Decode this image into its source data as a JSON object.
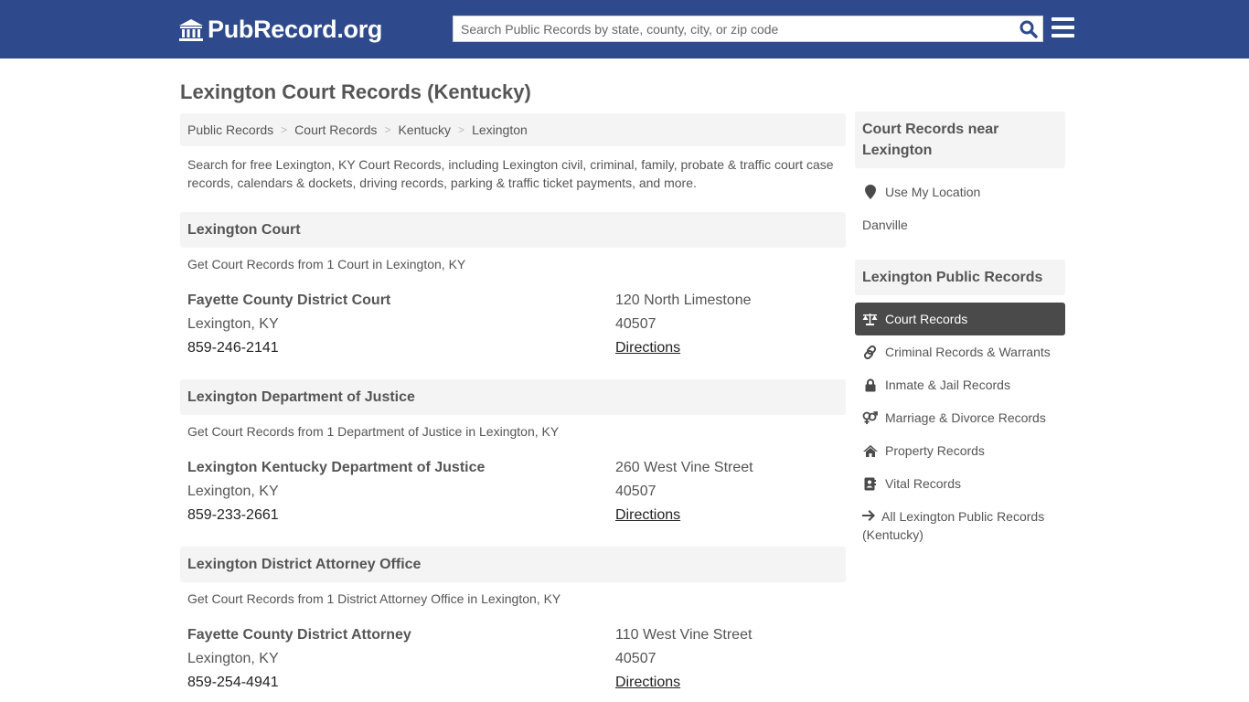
{
  "header": {
    "logo_text": "PubRecord.org",
    "search_placeholder": "Search Public Records by state, county, city, or zip code",
    "search_value": "",
    "brand_color": "#2e4a8c"
  },
  "page": {
    "title": "Lexington Court Records (Kentucky)",
    "breadcrumb": [
      "Public Records",
      "Court Records",
      "Kentucky",
      "Lexington"
    ],
    "intro": "Search for free Lexington, KY Court Records, including Lexington civil, criminal, family, probate & traffic court case records, calendars & dockets, driving records, parking & traffic ticket payments, and more."
  },
  "sections": [
    {
      "heading": "Lexington Court",
      "subtitle": "Get Court Records from 1 Court in Lexington, KY",
      "entry": {
        "name": "Fayette County District Court",
        "city": "Lexington, KY",
        "phone": "859-246-2141",
        "address": "120 North Limestone",
        "zip": "40507",
        "directions": "Directions"
      }
    },
    {
      "heading": "Lexington Department of Justice",
      "subtitle": "Get Court Records from 1 Department of Justice in Lexington, KY",
      "entry": {
        "name": "Lexington Kentucky Department of Justice",
        "city": "Lexington, KY",
        "phone": "859-233-2661",
        "address": "260 West Vine Street",
        "zip": "40507",
        "directions": "Directions"
      }
    },
    {
      "heading": "Lexington District Attorney Office",
      "subtitle": "Get Court Records from 1 District Attorney Office in Lexington, KY",
      "entry": {
        "name": "Fayette County District Attorney",
        "city": "Lexington, KY",
        "phone": "859-254-4941",
        "address": "110 West Vine Street",
        "zip": "40507",
        "directions": "Directions"
      }
    }
  ],
  "sidebar": {
    "nearby_heading": "Court Records near Lexington",
    "use_location": "Use My Location",
    "nearby": [
      "Danville"
    ],
    "records_heading": "Lexington Public Records",
    "items": [
      {
        "label": "Court Records",
        "icon": "balance-scale-icon",
        "active": true
      },
      {
        "label": "Criminal Records & Warrants",
        "icon": "link-icon",
        "active": false
      },
      {
        "label": "Inmate & Jail Records",
        "icon": "lock-icon",
        "active": false
      },
      {
        "label": "Marriage & Divorce Records",
        "icon": "venus-mars-icon",
        "active": false
      },
      {
        "label": "Property Records",
        "icon": "home-icon",
        "active": false
      },
      {
        "label": "Vital Records",
        "icon": "address-book-icon",
        "active": false
      }
    ],
    "all_records": "All Lexington Public Records (Kentucky)"
  }
}
